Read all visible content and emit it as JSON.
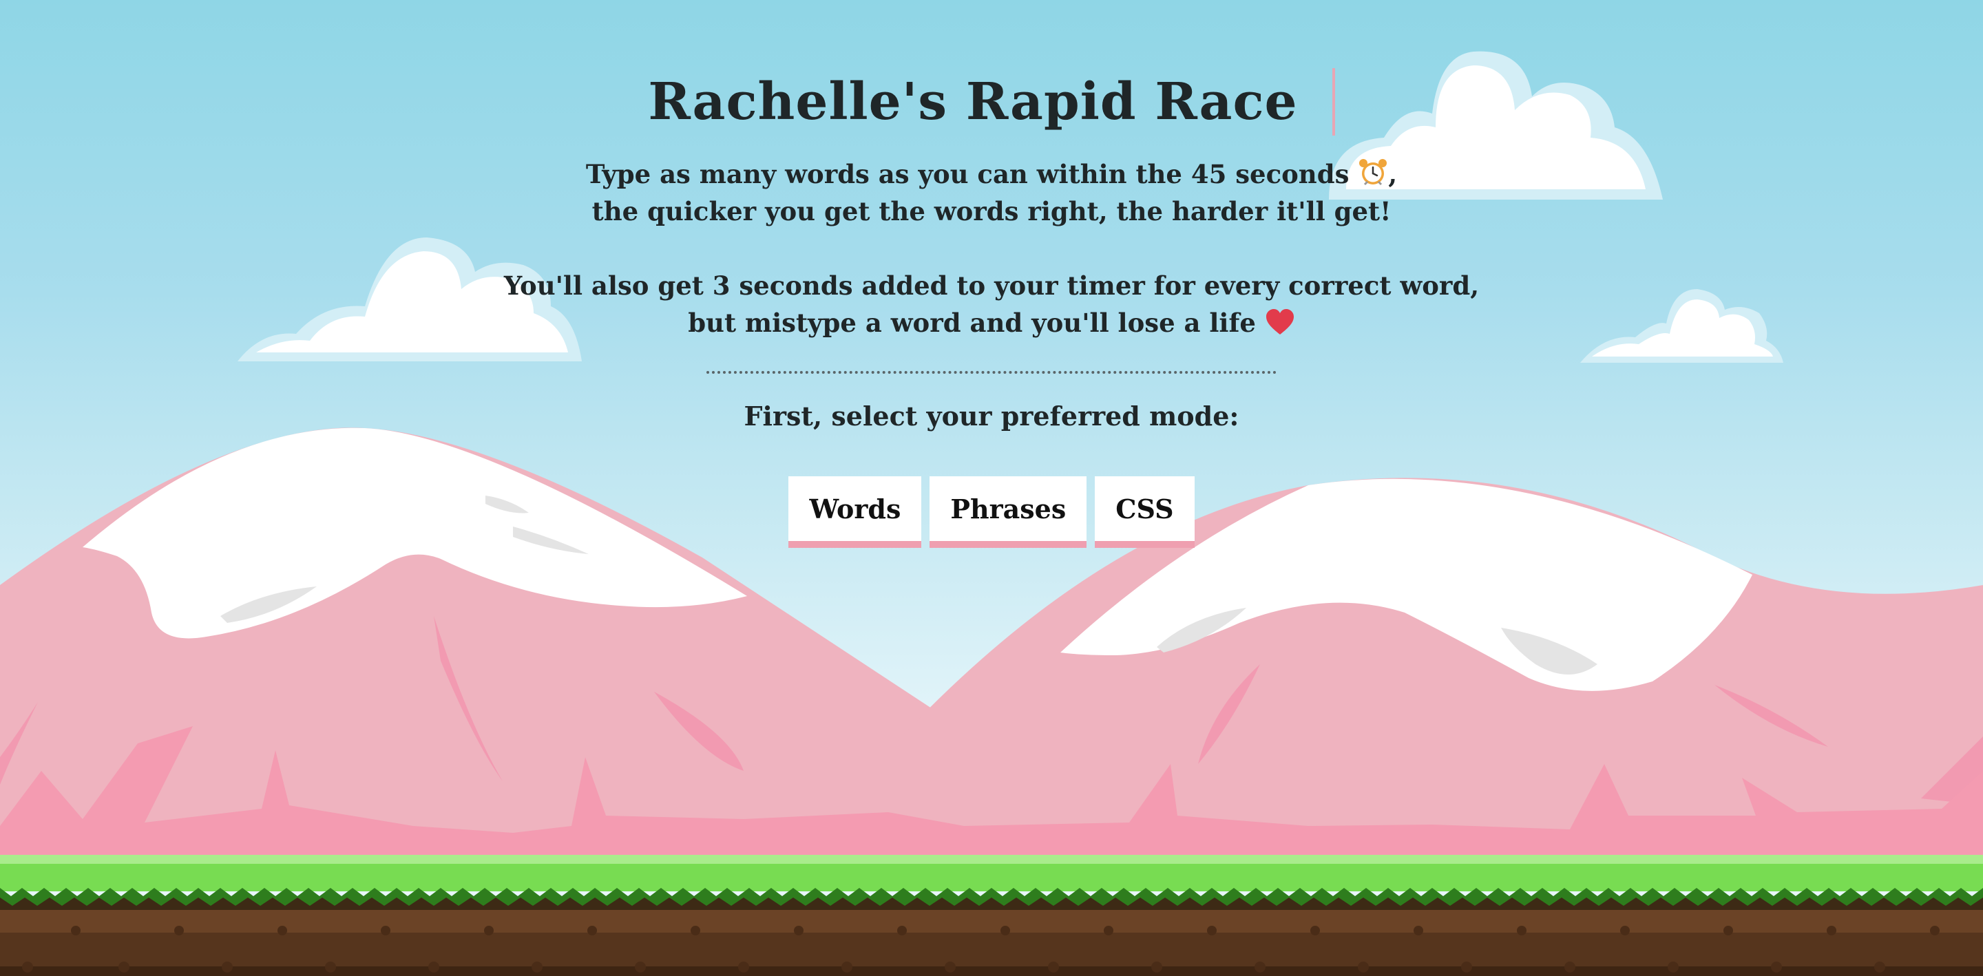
{
  "game": {
    "title": "Rachelle's Rapid Race",
    "intro_line1": "Type as many words as you can within the 45 seconds",
    "intro_line1_end": ",",
    "intro_line2": "the quicker you get the words right, the harder it'll get!",
    "intro_line3": "You'll also get 3 seconds added to your timer for every correct word,",
    "intro_line4": "but mistype a word and you'll lose a life",
    "mode_prompt": "First, select your preferred mode:",
    "modes": [
      "Words",
      "Phrases",
      "CSS"
    ],
    "icons": {
      "timer": "alarm-clock-icon",
      "life": "heart-icon"
    }
  },
  "colors": {
    "sky_top": "#8fd6e6",
    "mountain": "#efb3bf",
    "mountain_accent": "#f29ab1",
    "grass": "#7ddc55",
    "dirt": "#6b4326",
    "button_underline": "#ef9fb0",
    "heart": "#e23b4b"
  }
}
